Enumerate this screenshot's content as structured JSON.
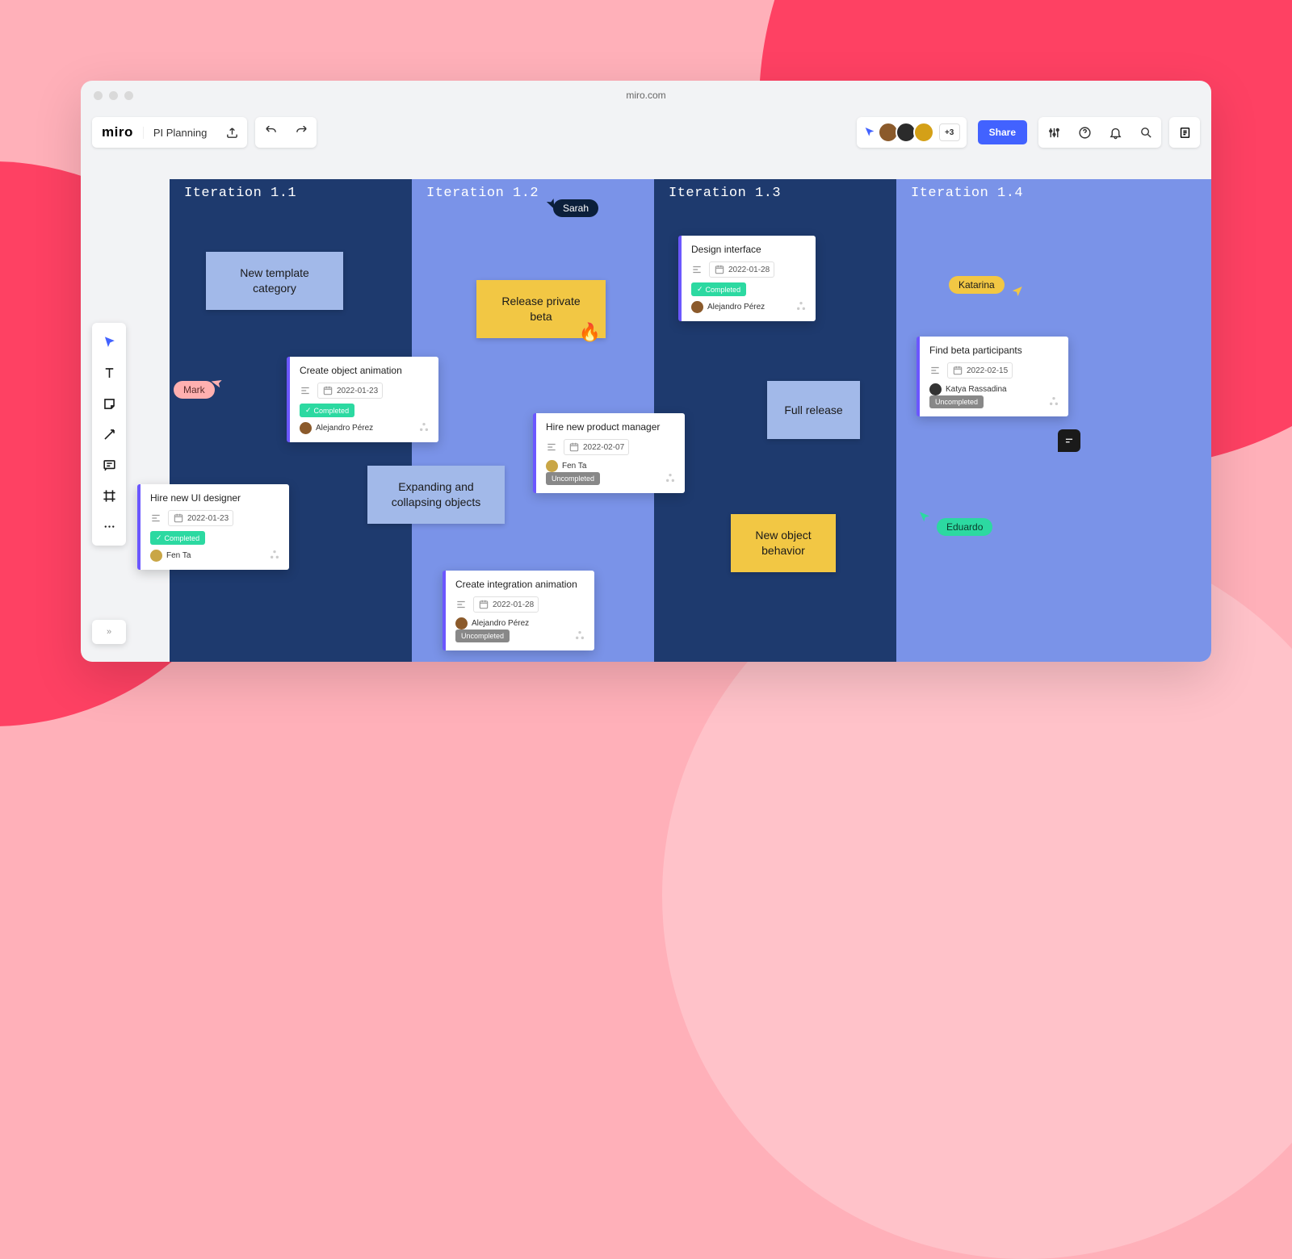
{
  "browser": {
    "url": "miro.com"
  },
  "app": {
    "logo": "miro",
    "board_title": "PI Planning"
  },
  "topbar": {
    "plus_count": "+3",
    "share_label": "Share"
  },
  "columns": [
    {
      "title": "Iteration 1.1"
    },
    {
      "title": "Iteration 1.2"
    },
    {
      "title": "Iteration 1.3"
    },
    {
      "title": "Iteration 1.4"
    }
  ],
  "sticky": {
    "new_template": "New template category",
    "release_beta": "Release private beta",
    "expand_collapse": "Expanding and collapsing objects",
    "full_release": "Full release",
    "new_object": "New object behavior"
  },
  "cards": {
    "create_anim": {
      "title": "Create object animation",
      "date": "2022-01-23",
      "status": "Completed",
      "assignee": "Alejandro Pérez"
    },
    "hire_ui": {
      "title": "Hire new UI designer",
      "date": "2022-01-23",
      "status": "Completed",
      "assignee": "Fen Ta"
    },
    "hire_pm": {
      "title": "Hire new product manager",
      "date": "2022-02-07",
      "status": "Uncompleted",
      "assignee": "Fen Ta"
    },
    "create_int": {
      "title": "Create integration animation",
      "date": "2022-01-28",
      "status": "Uncompleted",
      "assignee": "Alejandro Pérez"
    },
    "design_if": {
      "title": "Design interface",
      "date": "2022-01-28",
      "status": "Completed",
      "assignee": "Alejandro Pérez"
    },
    "find_beta": {
      "title": "Find beta participants",
      "date": "2022-02-15",
      "status": "Uncompleted",
      "assignee": "Katya Rassadina"
    }
  },
  "cursors": {
    "sarah": "Sarah",
    "mark": "Mark",
    "katarina": "Katarina",
    "eduardo": "Eduardo"
  }
}
